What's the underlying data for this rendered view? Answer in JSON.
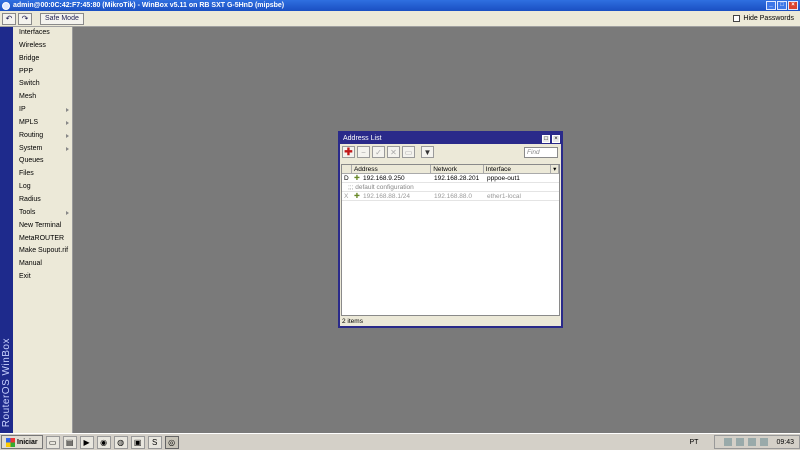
{
  "window": {
    "title": "admin@00:0C:42:F7:45:80 (MikroTik) - WinBox v5.11 on RB SXT G-5HnD (mipsbe)"
  },
  "toolbar": {
    "undo_icon": "undo-icon",
    "redo_icon": "redo-icon",
    "safe_mode_label": "Safe Mode",
    "hide_passwords_label": "Hide Passwords",
    "hide_passwords_checked": false
  },
  "side_banner": "RouterOS WinBox",
  "menu": {
    "items": [
      {
        "label": "Interfaces",
        "submenu": false
      },
      {
        "label": "Wireless",
        "submenu": false
      },
      {
        "label": "Bridge",
        "submenu": false
      },
      {
        "label": "PPP",
        "submenu": false
      },
      {
        "label": "Switch",
        "submenu": false
      },
      {
        "label": "Mesh",
        "submenu": false
      },
      {
        "label": "IP",
        "submenu": true
      },
      {
        "label": "MPLS",
        "submenu": true
      },
      {
        "label": "Routing",
        "submenu": true
      },
      {
        "label": "System",
        "submenu": true
      },
      {
        "label": "Queues",
        "submenu": false
      },
      {
        "label": "Files",
        "submenu": false
      },
      {
        "label": "Log",
        "submenu": false
      },
      {
        "label": "Radius",
        "submenu": false
      },
      {
        "label": "Tools",
        "submenu": true
      },
      {
        "label": "New Terminal",
        "submenu": false
      },
      {
        "label": "MetaROUTER",
        "submenu": false
      },
      {
        "label": "Make Supout.rif",
        "submenu": false
      },
      {
        "label": "Manual",
        "submenu": false
      },
      {
        "label": "Exit",
        "submenu": false
      }
    ]
  },
  "address_list": {
    "title": "Address List",
    "find_placeholder": "Find",
    "columns": [
      "Address",
      "Network",
      "Interface"
    ],
    "rows": [
      {
        "flag": "D",
        "address": "192.168.9.250",
        "network": "192.168.28.201",
        "interface": "pppoe-out1",
        "disabled": false
      },
      {
        "comment": ";;; default configuration"
      },
      {
        "flag": "X",
        "address": "192.168.88.1/24",
        "network": "192.168.88.0",
        "interface": "ether1-local",
        "disabled": true
      }
    ],
    "status": "2 items"
  },
  "taskbar": {
    "start_label": "Iniciar",
    "language": "PT",
    "clock": "09:43"
  }
}
